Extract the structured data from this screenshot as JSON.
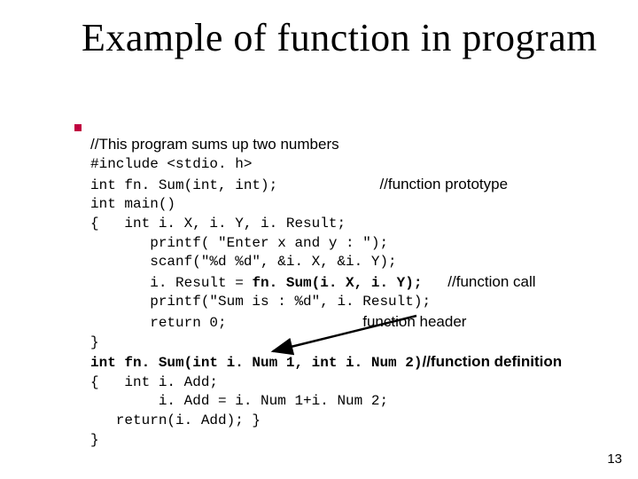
{
  "title": "Example of function in\nprogram",
  "code": {
    "line1": "//This program sums up two numbers",
    "line2": "#include <stdio. h>",
    "line3": "int fn. Sum(int, int);",
    "line4": "int main()",
    "line5": "{   int i. X, i. Y, i. Result;",
    "line6": "       printf( \"Enter x and y : \");",
    "line7": "       scanf(\"%d %d\", &i. X, &i. Y);",
    "line8a": "       i. Result = ",
    "line8b": "fn. Sum(i. X, i. Y);",
    "line9": "       printf(\"Sum is : %d\", i. Result);",
    "line10": "       return 0;",
    "line11": "}",
    "line12": "int fn. Sum(int i. Num 1, int i. Num 2)",
    "line13": "{   int i. Add;",
    "line14": "        i. Add = i. Num 1+i. Num 2;",
    "line15": "   return(i. Add); }",
    "line16": "}"
  },
  "annotations": {
    "prototype": "//function prototype",
    "call": "//function call",
    "header": "function header",
    "definition": "//function definition"
  },
  "page_number": "13"
}
